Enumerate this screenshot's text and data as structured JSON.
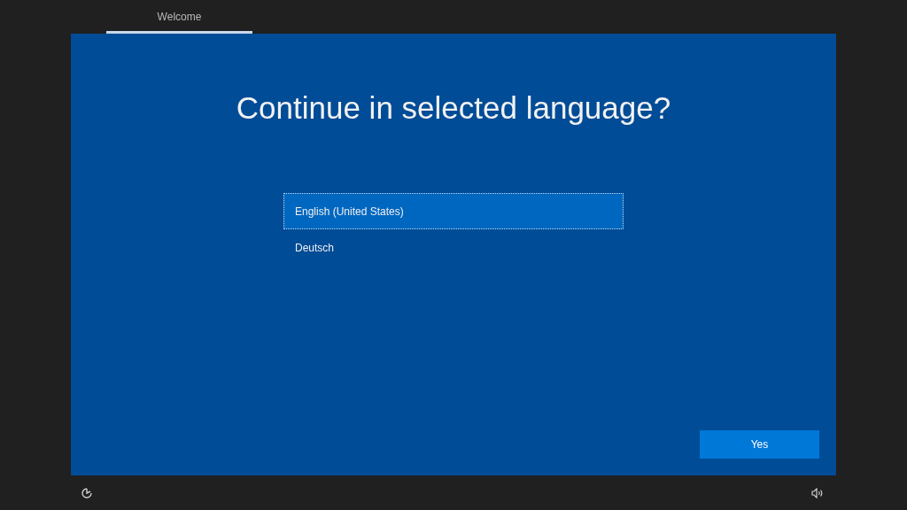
{
  "tabs": [
    {
      "label": "Welcome",
      "selected": true
    }
  ],
  "title": "Continue in selected language?",
  "languages": [
    {
      "label": "English (United States)",
      "selected": true
    },
    {
      "label": "Deutsch",
      "selected": false
    }
  ],
  "buttons": [
    "Yes"
  ]
}
